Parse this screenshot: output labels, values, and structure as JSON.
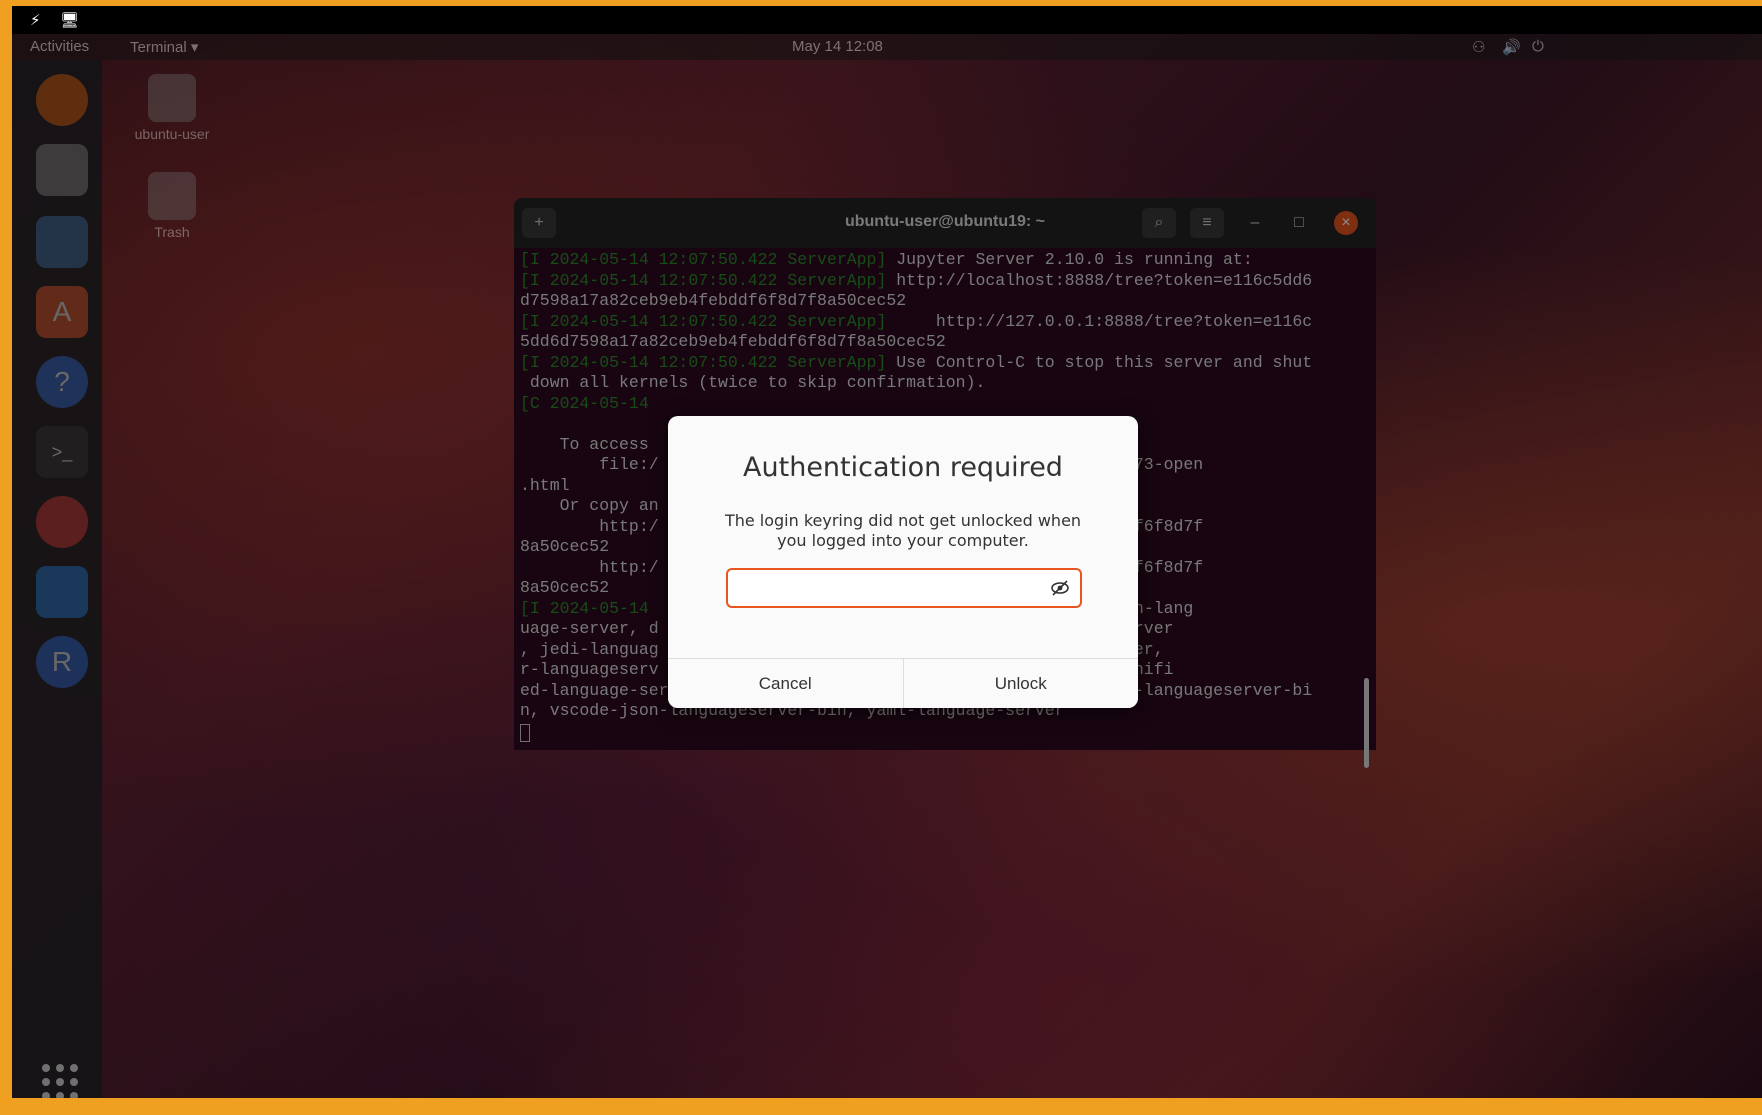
{
  "topbar": {
    "activities": "Activities",
    "app": "Terminal ▾",
    "datetime": "May 14  12:08"
  },
  "desktop": {
    "home_label": "ubuntu-user",
    "trash_label": "Trash"
  },
  "terminal": {
    "title": "ubuntu-user@ubuntu19: ~",
    "lines": [
      {
        "prefix": "[I 2024-05-14 12:07:50.422 ServerApp]",
        "text": " Jupyter Server 2.10.0 is running at:"
      },
      {
        "prefix": "[I 2024-05-14 12:07:50.422 ServerApp]",
        "text": " http://localhost:8888/tree?token=e116c5dd6"
      },
      {
        "prefix": "",
        "text": "d7598a17a82ceb9eb4febddf6f8d7f8a50cec52"
      },
      {
        "prefix": "[I 2024-05-14 12:07:50.422 ServerApp]",
        "text": "     http://127.0.0.1:8888/tree?token=e116c"
      },
      {
        "prefix": "",
        "text": "5dd6d7598a17a82ceb9eb4febddf6f8d7f8a50cec52"
      },
      {
        "prefix": "[I 2024-05-14 12:07:50.422 ServerApp]",
        "text": " Use Control-C to stop this server and shut"
      },
      {
        "prefix": "",
        "text": " down all kernels (twice to skip confirmation)."
      },
      {
        "prefix": "[C 2024-05-14",
        "text": ""
      },
      {
        "prefix": "",
        "text": ""
      },
      {
        "prefix": "",
        "text": "    To access"
      },
      {
        "prefix": "",
        "text": "        file:/                                   e/jpserver-2673-open"
      },
      {
        "prefix": "",
        "text": ".html"
      },
      {
        "prefix": "",
        "text": "    Or copy an"
      },
      {
        "prefix": "",
        "text": "        http:/                                   2ceb9eb4febddf6f8d7f"
      },
      {
        "prefix": "",
        "text": "8a50cec52"
      },
      {
        "prefix": "",
        "text": "        http:/                                   2ceb9eb4febddf6f8d7f"
      },
      {
        "prefix": "",
        "text": "8a50cec52"
      },
      {
        "prefix": "[I 2024-05-14",
        "text": "                                   server(s): bash-lang"
      },
      {
        "prefix": "",
        "text": "uage-server, d                                ypescript-langserver"
      },
      {
        "prefix": "",
        "text": ", jedi-languag                                on-language-server,"
      },
      {
        "prefix": "",
        "text": "r-languageserv                                nguage-server, unifi"
      },
      {
        "prefix": "",
        "text": "ed-language-server, vscode-css-languageserver-bin, vscode-html-languageserver-bi"
      },
      {
        "prefix": "",
        "text": "n, vscode-json-languageserver-bin, yaml-language-server"
      }
    ]
  },
  "dialog": {
    "title": "Authentication required",
    "message": "The login keyring did not get unlocked when you logged into your computer.",
    "password_value": "",
    "cancel_label": "Cancel",
    "unlock_label": "Unlock"
  },
  "colors": {
    "accent": "#e95420",
    "dialog_bg": "#fafafa"
  }
}
